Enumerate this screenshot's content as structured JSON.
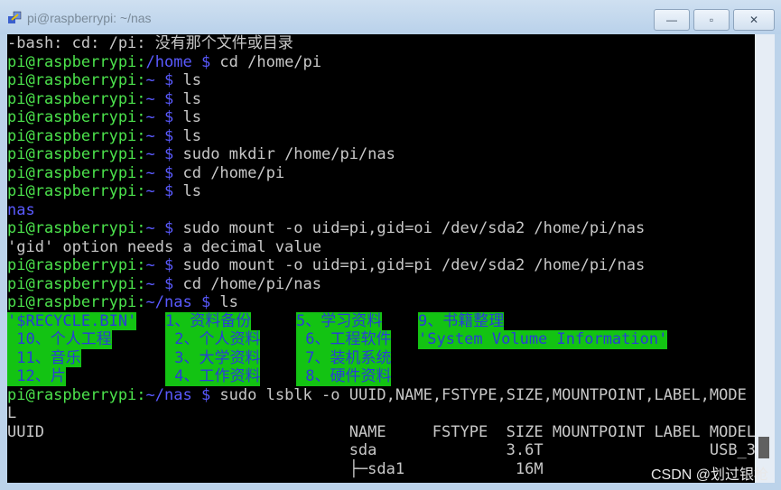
{
  "window": {
    "title": "pi@raspberrypi: ~/nas",
    "minimize": "—",
    "maximize": "▫",
    "close": "✕"
  },
  "lines": [
    [
      [
        "w",
        "-bash: cd: /pi: 没有那个文件或目录"
      ]
    ],
    [
      [
        "g",
        "pi@raspberrypi:"
      ],
      [
        "b",
        "/home $"
      ],
      [
        "w",
        " cd /home/pi"
      ]
    ],
    [
      [
        "g",
        "pi@raspberrypi:"
      ],
      [
        "b",
        "~ $"
      ],
      [
        "w",
        " ls"
      ]
    ],
    [
      [
        "g",
        "pi@raspberrypi:"
      ],
      [
        "b",
        "~ $"
      ],
      [
        "w",
        " ls"
      ]
    ],
    [
      [
        "g",
        "pi@raspberrypi:"
      ],
      [
        "b",
        "~ $"
      ],
      [
        "w",
        " ls"
      ]
    ],
    [
      [
        "g",
        "pi@raspberrypi:"
      ],
      [
        "b",
        "~ $"
      ],
      [
        "w",
        " ls"
      ]
    ],
    [
      [
        "g",
        "pi@raspberrypi:"
      ],
      [
        "b",
        "~ $"
      ],
      [
        "w",
        " sudo mkdir /home/pi/nas"
      ]
    ],
    [
      [
        "g",
        "pi@raspberrypi:"
      ],
      [
        "b",
        "~ $"
      ],
      [
        "w",
        " cd /home/pi"
      ]
    ],
    [
      [
        "g",
        "pi@raspberrypi:"
      ],
      [
        "b",
        "~ $"
      ],
      [
        "w",
        " ls"
      ]
    ],
    [
      [
        "b",
        "nas"
      ]
    ],
    [
      [
        "g",
        "pi@raspberrypi:"
      ],
      [
        "b",
        "~ $"
      ],
      [
        "w",
        " sudo mount -o uid=pi,gid=oi /dev/sda2 /home/pi/nas"
      ]
    ],
    [
      [
        "w",
        "'gid' option needs a decimal value"
      ]
    ],
    [
      [
        "g",
        "pi@raspberrypi:"
      ],
      [
        "b",
        "~ $"
      ],
      [
        "w",
        " sudo mount -o uid=pi,gid=pi /dev/sda2 /home/pi/nas"
      ]
    ],
    [
      [
        "g",
        "pi@raspberrypi:"
      ],
      [
        "b",
        "~ $"
      ],
      [
        "w",
        " cd /home/pi/nas"
      ]
    ],
    [
      [
        "g",
        "pi@raspberrypi:"
      ],
      [
        "b",
        "~/nas $"
      ],
      [
        "w",
        " ls"
      ]
    ]
  ],
  "ls_grid": [
    [
      "'$RECYCLE.BIN'",
      "1、资料备份",
      "5、学习资料",
      "9、书籍整理"
    ],
    [
      " 10、个人工程",
      " 2、个人资料",
      " 6、工程软件",
      "'System Volume Information'"
    ],
    [
      " 11、音乐",
      " 3、大学资料",
      " 7、装机系统",
      ""
    ],
    [
      " 12、片",
      " 4、工作资料",
      " 8、硬件资料",
      ""
    ]
  ],
  "after": [
    [
      [
        "g",
        "pi@raspberrypi:"
      ],
      [
        "b",
        "~/nas $"
      ],
      [
        "w",
        " sudo lsblk -o UUID,NAME,FSTYPE,SIZE,MOUNTPOINT,LABEL,MODE"
      ]
    ],
    [
      [
        "w",
        "L"
      ]
    ],
    [
      [
        "w",
        "UUID                                 NAME     FSTYPE  SIZE MOUNTPOINT LABEL MODEL"
      ]
    ],
    [
      [
        "w",
        "                                     sda              3.6T                  USB_3"
      ]
    ],
    [
      [
        "w",
        "                                     ├─sda1            16M"
      ]
    ]
  ],
  "watermark": "CSDN @划过银枪"
}
